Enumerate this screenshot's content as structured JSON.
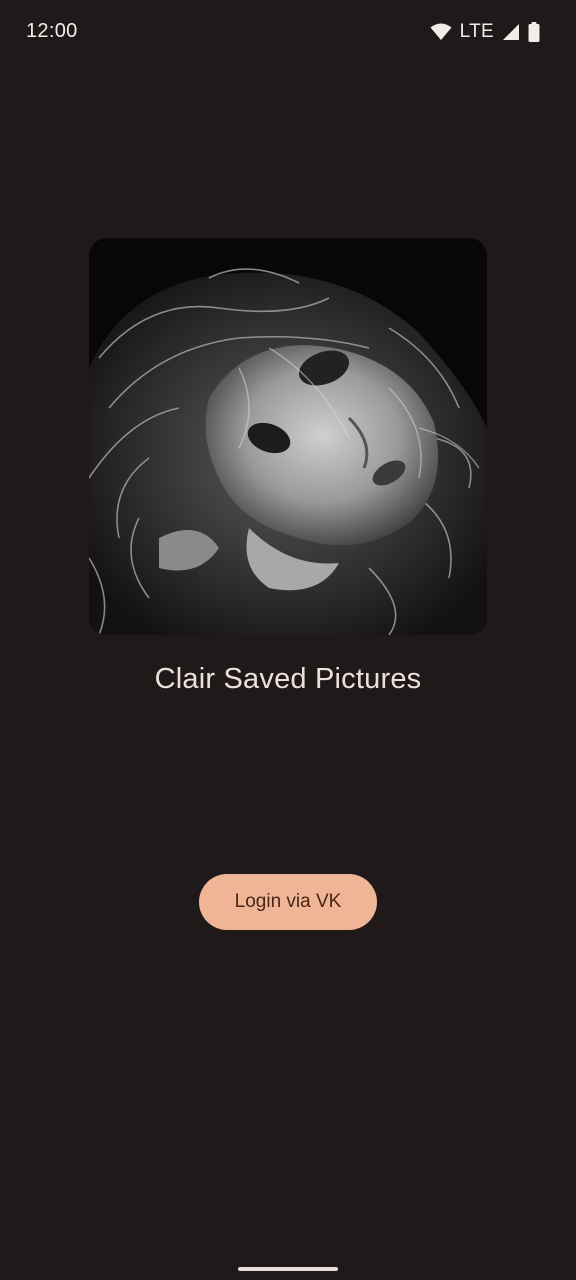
{
  "status_bar": {
    "time": "12:00",
    "network": "LTE",
    "icons": [
      "wifi-icon",
      "cellular-signal-icon",
      "battery-icon"
    ]
  },
  "main": {
    "hero_image": "black-and-white portrait photo",
    "app_title": "Clair Saved Pictures",
    "login_button_label": "Login via VK"
  },
  "colors": {
    "background": "#1f1a19",
    "title_text": "#ece0dc",
    "button_background": "#f0b597",
    "button_text": "#4a2516"
  }
}
